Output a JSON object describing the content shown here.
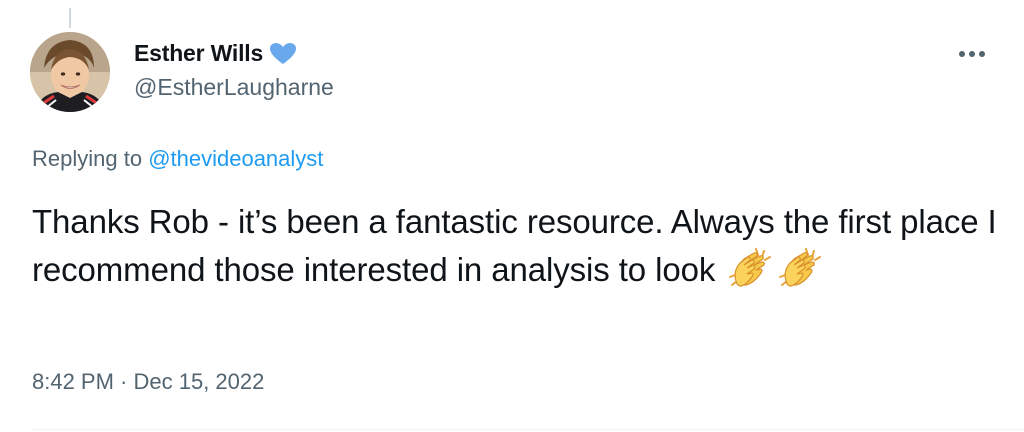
{
  "author": {
    "display_name": "Esther Wills",
    "handle": "@EstherLaugharne",
    "verified": true,
    "verified_color": "#6aa8ee"
  },
  "icons": {
    "avatar": "profile-photo",
    "verified": "verified-heart-icon",
    "more": "more-horizontal-icon",
    "emoji": "clapping-hands-emoji"
  },
  "reply": {
    "prefix": "Replying to ",
    "mention": "@thevideoanalyst"
  },
  "tweet": {
    "text": "Thanks Rob - it’s been a fantastic resource. Always the first place I recommend those interested in analysis to look ",
    "emojis": [
      "clapping-hands",
      "clapping-hands"
    ]
  },
  "meta": {
    "timestamp": "8:42 PM · Dec 15, 2022"
  },
  "colors": {
    "text_primary": "#0f1419",
    "text_secondary": "#536471",
    "link": "#1d9bf0"
  }
}
